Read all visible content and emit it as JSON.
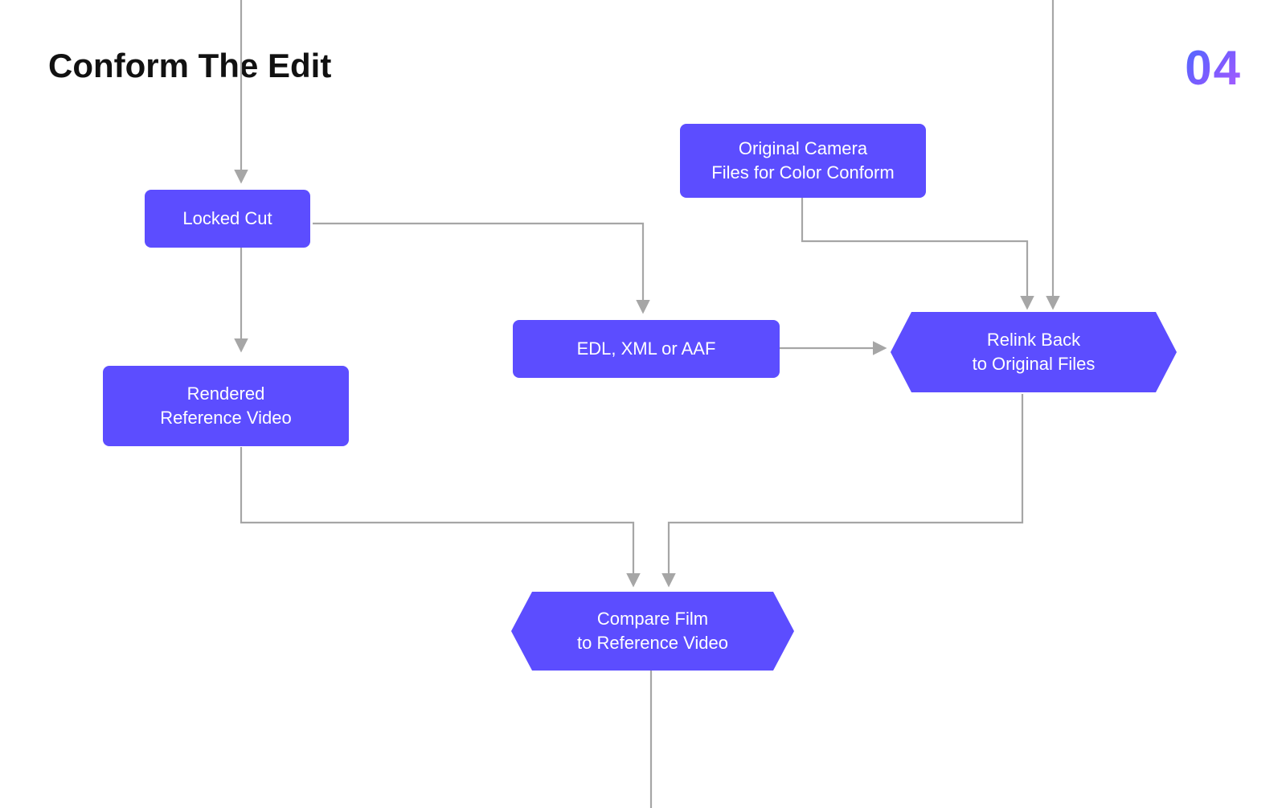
{
  "title": "Conform The Edit",
  "step_number": "04",
  "nodes": {
    "locked_cut": "Locked Cut",
    "original_camera_line1": "Original Camera",
    "original_camera_line2": "Files for Color Conform",
    "rendered_ref_line1": "Rendered",
    "rendered_ref_line2": "Reference Video",
    "edl": "EDL, XML or AAF",
    "relink_line1": "Relink Back",
    "relink_line2": "to Original Files",
    "compare_line1": "Compare Film",
    "compare_line2": "to Reference Video"
  },
  "colors": {
    "node": "#5c4dff",
    "connector": "#A6A6A6"
  }
}
